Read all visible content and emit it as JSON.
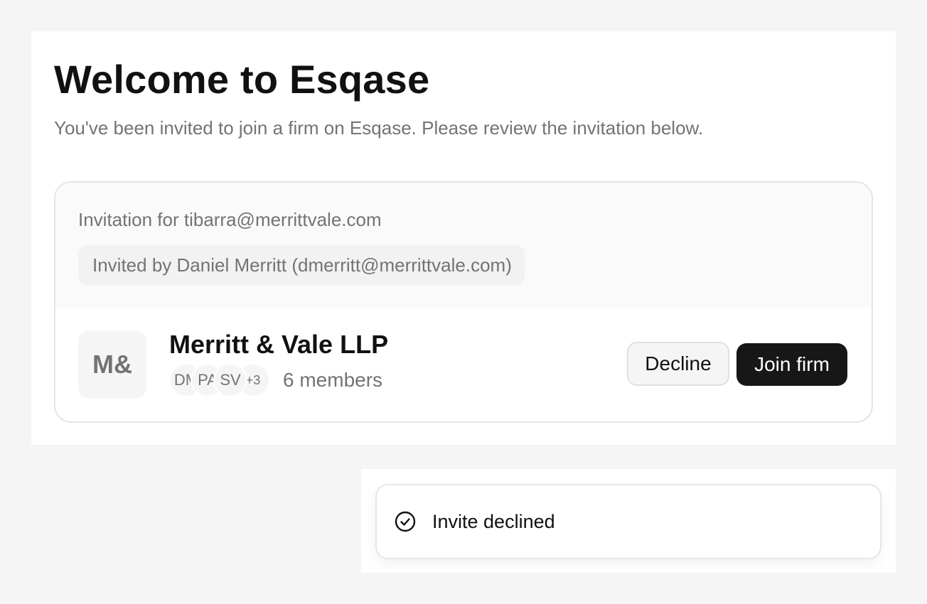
{
  "page": {
    "title": "Welcome to Esqase",
    "subtitle": "You've been invited to join a firm on Esqase. Please review the invitation below."
  },
  "invitation": {
    "for_text": "Invitation for tibarra@merrittvale.com",
    "invited_by": "Invited by Daniel Merritt (dmerritt@merrittvale.com)"
  },
  "firm": {
    "logo_text": "M&",
    "name": "Merritt & Vale LLP",
    "avatars": [
      "DM",
      "PA",
      "SV",
      "+3"
    ],
    "member_count": "6 members"
  },
  "actions": {
    "decline_label": "Decline",
    "join_label": "Join firm"
  },
  "toast": {
    "icon": "check-circle-icon",
    "message": "Invite declined"
  },
  "colors": {
    "background": "#f5f5f5",
    "primary_button": "#171717",
    "muted_text": "#737373"
  }
}
